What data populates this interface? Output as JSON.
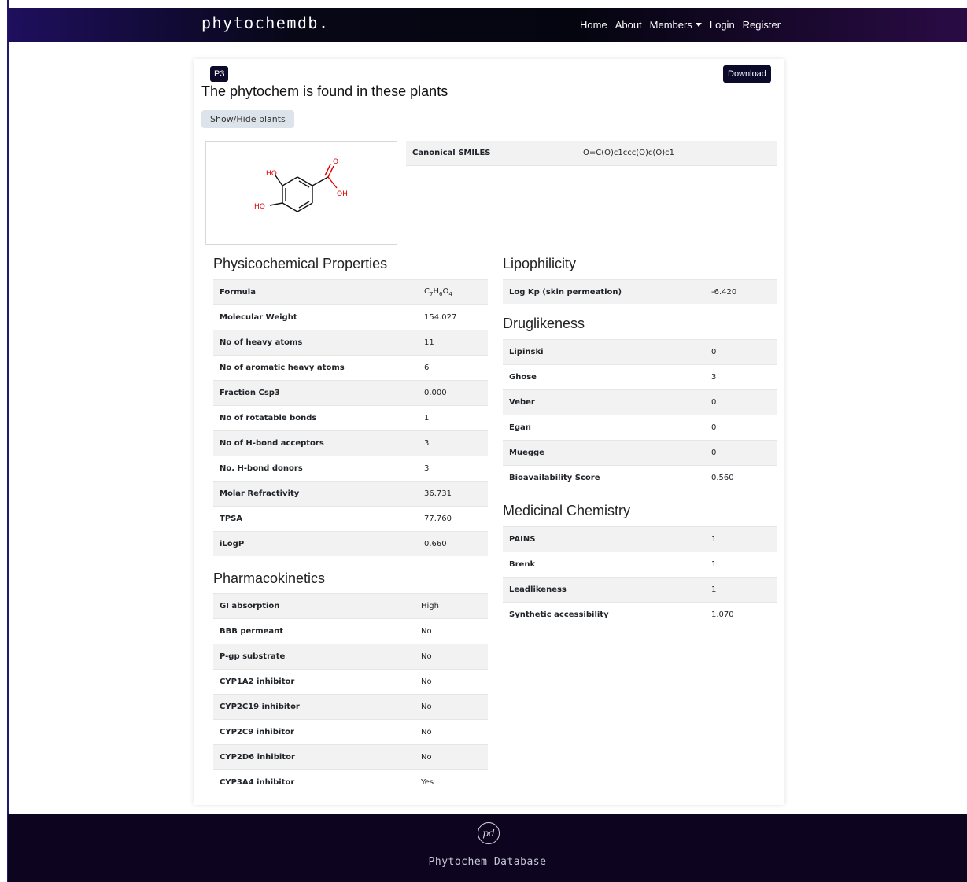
{
  "nav": {
    "brand": "phytochemdb.",
    "home": "Home",
    "about": "About",
    "members": "Members",
    "login": "Login",
    "register": "Register"
  },
  "compound": {
    "id": "P3",
    "download_label": "Download",
    "found_heading": "The phytochem is found in these plants",
    "toggle_label": "Show/Hide plants",
    "smiles_label": "Canonical SMILES",
    "smiles_value": "O=C(O)c1ccc(O)c(O)c1",
    "structure_labels": {
      "ho_top": "HO",
      "ho_left": "HO",
      "o": "O",
      "oh": "OH"
    }
  },
  "physicochemical": {
    "title": "Physicochemical Properties",
    "rows": [
      {
        "label": "Formula",
        "value": "C7H6O4"
      },
      {
        "label": "Molecular Weight",
        "value": "154.027"
      },
      {
        "label": "No of heavy atoms",
        "value": "11"
      },
      {
        "label": "No of aromatic heavy atoms",
        "value": "6"
      },
      {
        "label": "Fraction Csp3",
        "value": "0.000"
      },
      {
        "label": "No of rotatable bonds",
        "value": "1"
      },
      {
        "label": "No of H-bond acceptors",
        "value": "3"
      },
      {
        "label": "No. H-bond donors",
        "value": "3"
      },
      {
        "label": "Molar Refractivity",
        "value": "36.731"
      },
      {
        "label": "TPSA",
        "value": "77.760"
      },
      {
        "label": "iLogP",
        "value": "0.660"
      }
    ]
  },
  "pharmacokinetics": {
    "title": "Pharmacokinetics",
    "rows": [
      {
        "label": "GI absorption",
        "value": "High"
      },
      {
        "label": "BBB permeant",
        "value": "No"
      },
      {
        "label": "P-gp substrate",
        "value": "No"
      },
      {
        "label": "CYP1A2 inhibitor",
        "value": "No"
      },
      {
        "label": "CYP2C19 inhibitor",
        "value": "No"
      },
      {
        "label": "CYP2C9 inhibitor",
        "value": "No"
      },
      {
        "label": "CYP2D6 inhibitor",
        "value": "No"
      },
      {
        "label": "CYP3A4 inhibitor",
        "value": "Yes"
      }
    ]
  },
  "lipophilicity": {
    "title": "Lipophilicity",
    "rows": [
      {
        "label": "Log Kp (skin permeation)",
        "value": "-6.420"
      }
    ]
  },
  "druglikeness": {
    "title": "Druglikeness",
    "rows": [
      {
        "label": "Lipinski",
        "value": "0"
      },
      {
        "label": "Ghose",
        "value": "3"
      },
      {
        "label": "Veber",
        "value": "0"
      },
      {
        "label": "Egan",
        "value": "0"
      },
      {
        "label": "Muegge",
        "value": "0"
      },
      {
        "label": "Bioavailability Score",
        "value": "0.560"
      }
    ]
  },
  "medicinal": {
    "title": "Medicinal Chemistry",
    "rows": [
      {
        "label": "PAINS",
        "value": "1"
      },
      {
        "label": "Brenk",
        "value": "1"
      },
      {
        "label": "Leadlikeness",
        "value": "1"
      },
      {
        "label": "Synthetic accessibility",
        "value": "1.070"
      }
    ]
  },
  "footer": {
    "logo_text": "pd",
    "text": "Phytochem Database"
  },
  "colors": {
    "navy": "#0c0a2b",
    "stripe": "#f2f2f2",
    "heteroatom_red": "#e00000"
  }
}
